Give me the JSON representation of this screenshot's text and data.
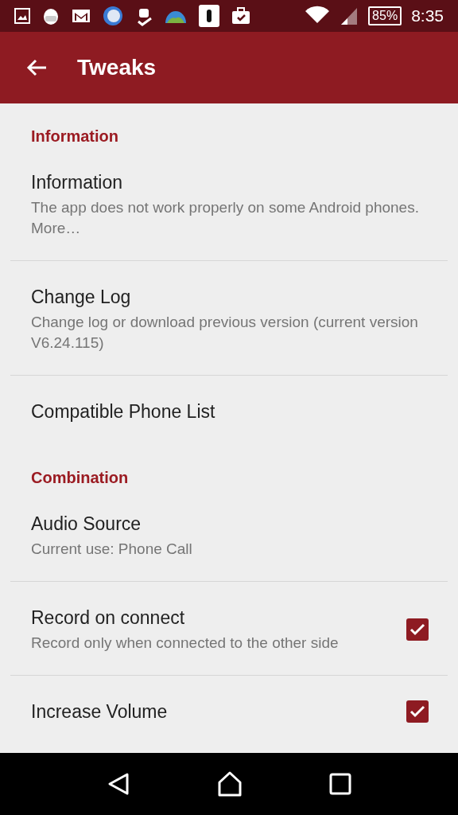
{
  "status_bar": {
    "battery": "85%",
    "time": "8:35"
  },
  "app_bar": {
    "title": "Tweaks"
  },
  "sections": [
    {
      "header": "Information",
      "items": [
        {
          "kind": "plain",
          "title": "Information",
          "subtitle": "The app does not work properly on some Android phones. More…"
        },
        {
          "kind": "plain",
          "title": "Change Log",
          "subtitle": "Change log or download previous version (current version V6.24.115)"
        },
        {
          "kind": "plain",
          "title": "Compatible Phone List"
        }
      ]
    },
    {
      "header": "Combination",
      "items": [
        {
          "kind": "plain",
          "title": "Audio Source",
          "subtitle": "Current use: Phone Call"
        },
        {
          "kind": "checkbox",
          "title": "Record on connect",
          "subtitle": "Record only when connected to the other side",
          "checked": true
        },
        {
          "kind": "checkbox",
          "title": "Increase Volume",
          "checked": true
        }
      ]
    }
  ]
}
